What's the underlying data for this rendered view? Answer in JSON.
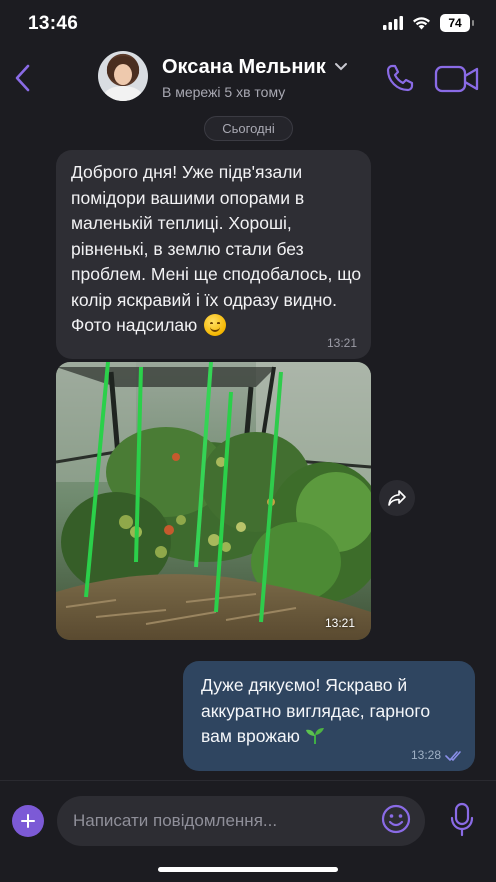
{
  "status_bar": {
    "time": "13:46",
    "battery": "74"
  },
  "header": {
    "contact_name": "Оксана Мельник",
    "contact_status": "В мережі 5 хв тому"
  },
  "chat": {
    "date_label": "Сьогодні",
    "messages": [
      {
        "direction": "incoming",
        "text": "Доброго дня! Уже підв'язали помідори вашими опорами в маленькій теплиці. Хороші, рівненькі, в землю стали без проблем. Мені ще сподобалось, що колір яскравий і їх одразу видно. Фото надсилаю",
        "emoji": "smiling-face-icon",
        "time": "13:21"
      },
      {
        "direction": "incoming",
        "type": "photo",
        "time": "13:21"
      },
      {
        "direction": "outgoing",
        "text": "Дуже дякуємо! Яскраво й аккуратно виглядає, гарного вам врожаю",
        "emoji": "seedling-icon",
        "time": "13:28",
        "status": "read"
      }
    ]
  },
  "composer": {
    "placeholder": "Написати повідомлення..."
  },
  "colors": {
    "background": "#1c1c21",
    "incoming_bubble": "#2e2e34",
    "outgoing_bubble": "#2f4560",
    "accent": "#7c5ad6"
  }
}
